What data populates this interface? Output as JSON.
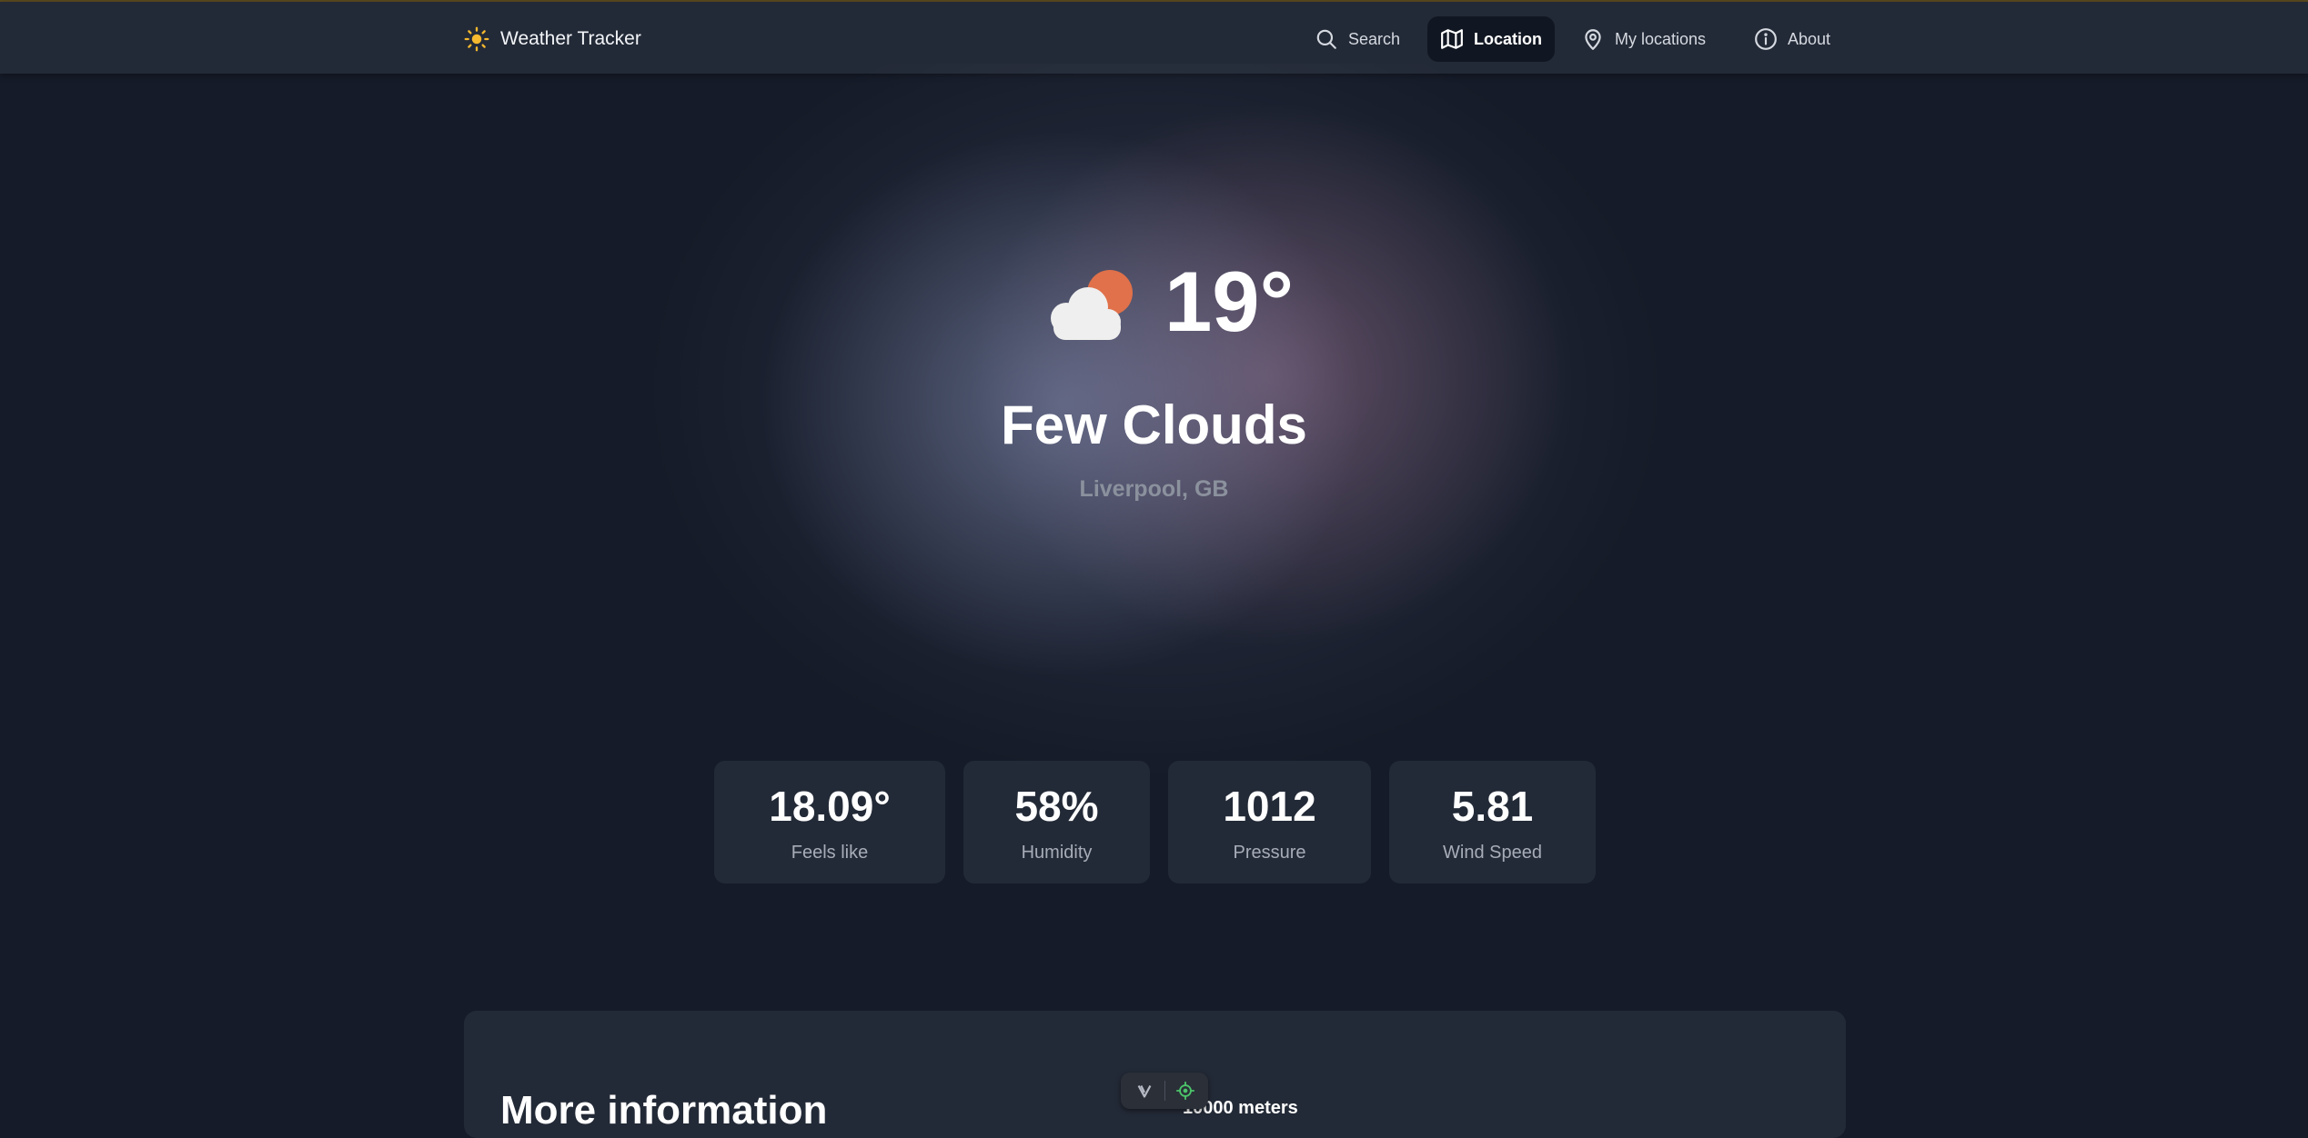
{
  "app": {
    "title": "Weather Tracker",
    "logo_icon": "sun-icon",
    "accent": "#f5b82e"
  },
  "nav": {
    "items": [
      {
        "label": "Search",
        "icon": "search-icon",
        "active": false
      },
      {
        "label": "Location",
        "icon": "map-icon",
        "active": true
      },
      {
        "label": "My locations",
        "icon": "map-pin-icon",
        "active": false
      },
      {
        "label": "About",
        "icon": "info-icon",
        "active": false
      }
    ]
  },
  "current": {
    "icon": "few-clouds-icon",
    "temperature": "19°",
    "condition": "Few Clouds",
    "location": "Liverpool, GB"
  },
  "stats": [
    {
      "value": "18.09°",
      "label": "Feels like"
    },
    {
      "value": "58%",
      "label": "Humidity"
    },
    {
      "value": "1012",
      "label": "Pressure"
    },
    {
      "value": "5.81",
      "label": "Wind Speed"
    }
  ],
  "more_info": {
    "title": "More information",
    "visibility": "10000 meters"
  },
  "map_controls": {
    "icons": [
      "chevron-down-icon",
      "crosshair-icon"
    ]
  },
  "colors": {
    "background": "#151b28",
    "card": "#232a37",
    "muted_text": "#8b919d",
    "sun": "#e0714a"
  }
}
